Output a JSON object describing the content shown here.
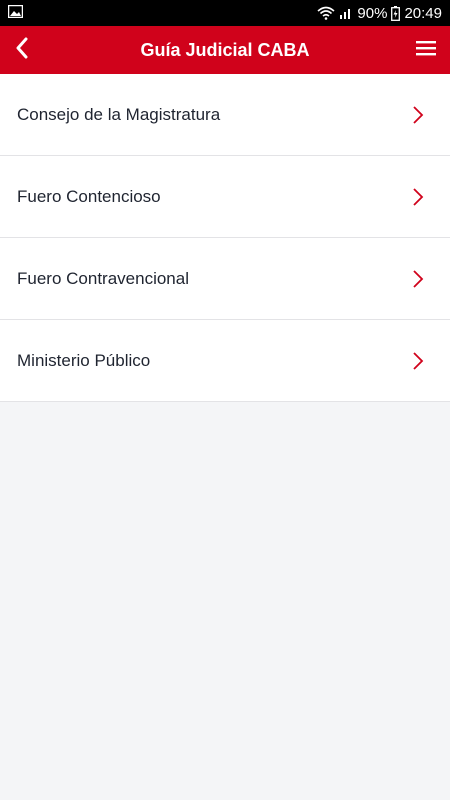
{
  "status_bar": {
    "battery": "90%",
    "time": "20:49",
    "icons": [
      "image-icon",
      "wifi-icon",
      "signal-icon",
      "battery-icon"
    ]
  },
  "app_bar": {
    "title": "Guía Judicial CABA",
    "back_icon": "chevron-left-icon",
    "menu_icon": "hamburger-menu-icon",
    "color": "#d0021b"
  },
  "list": {
    "items": [
      {
        "label": "Consejo de la Magistratura"
      },
      {
        "label": "Fuero Contencioso"
      },
      {
        "label": "Fuero Contravencional"
      },
      {
        "label": "Ministerio Público"
      }
    ],
    "chevron_color": "#d0021b"
  }
}
